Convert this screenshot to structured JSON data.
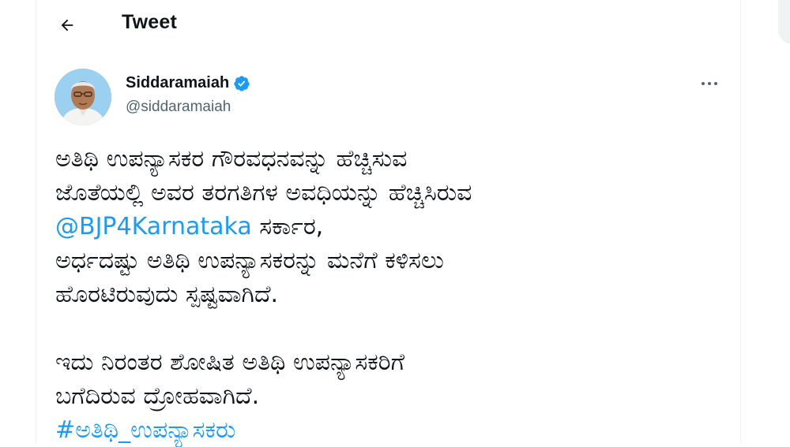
{
  "header": {
    "title": "Tweet",
    "back_icon": "arrow-left-icon"
  },
  "author": {
    "name": "Siddaramaiah",
    "handle": "@siddaramaiah",
    "verified_icon": "verified-badge-icon",
    "more_icon": "more-horizontal-icon"
  },
  "tweet": {
    "line1": "ಅತಿಥಿ ಉಪನ್ಯಾಸಕರ ಗೌರವಧನವನ್ನು ಹೆಚ್ಚಿಸುವ",
    "line2": "ಜೊತೆಯಲ್ಲಿ ಅವರ ತರಗತಿಗಳ ಅವಧಿಯನ್ನು ಹೆಚ್ಚಿಸಿರುವ",
    "mention": "@BJP4Karnataka",
    "line3_rest": " ಸರ್ಕಾರ,",
    "line4": "ಅರ್ಧದಷ್ಟು ಅತಿಥಿ ಉಪನ್ಯಾಸಕರನ್ನು ಮನೆಗೆ ಕಳಿಸಲು",
    "line5": "ಹೊರಟಿರುವುದು ಸ್ಪಷ್ಟವಾಗಿದೆ.",
    "line6": "ಇದು ನಿರಂತರ ಶೋಷಿತ ಅತಿಥಿ ಉಪನ್ಯಾಸಕರಿಗೆ",
    "line7": "ಬಗೆದಿರುವ ದ್ರೋಹವಾಗಿದೆ.",
    "hashtag": "#ಅತಿಥಿ_ಉಪನ್ಯಾಸಕರು"
  },
  "colors": {
    "link": "#1d9bf0",
    "text": "#0f1419",
    "secondary": "#536471"
  }
}
